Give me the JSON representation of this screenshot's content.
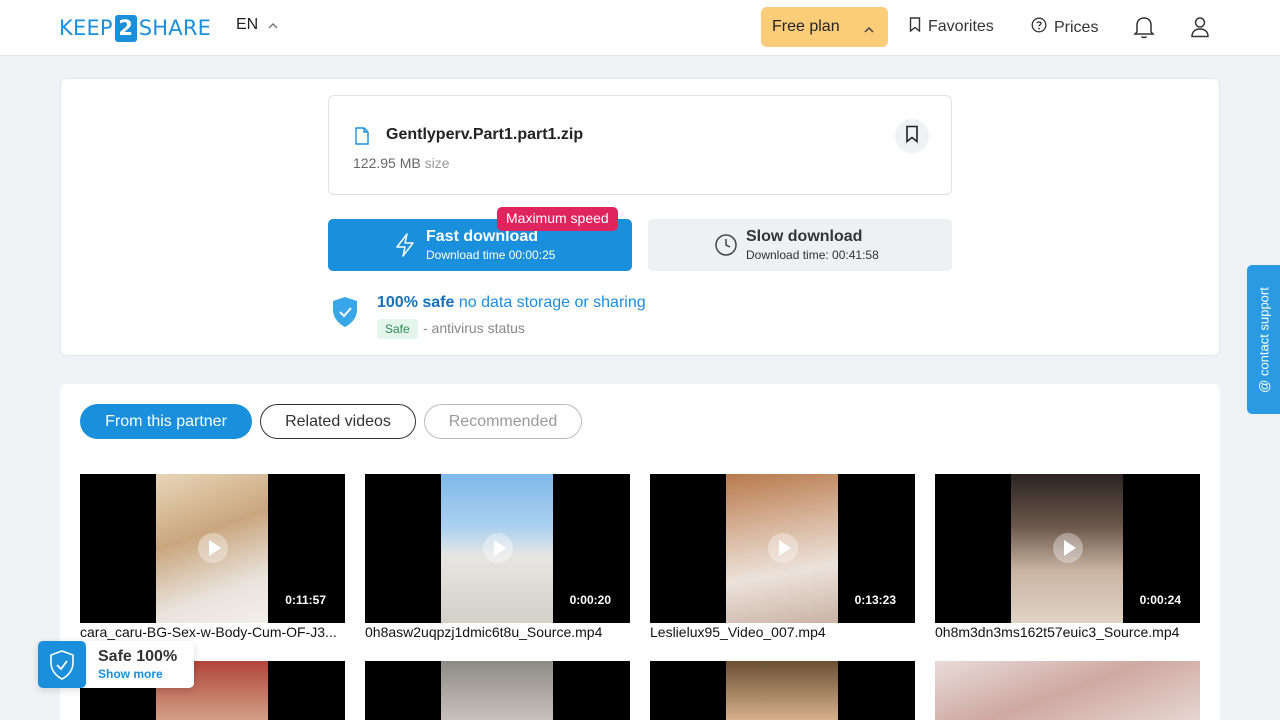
{
  "header": {
    "logo_left": "KEEP",
    "logo_mid": "2",
    "logo_right": "SHARE",
    "language": "EN",
    "free_plan_label": "Free plan",
    "favorites_label": "Favorites",
    "prices_label": "Prices"
  },
  "file": {
    "name": "Gentlyperv.Part1.part1.zip",
    "size_value": "122.95 MB",
    "size_unit": "size"
  },
  "download": {
    "badge": "Maximum speed",
    "fast_title": "Fast download",
    "fast_sub": "Download time 00:00:25",
    "slow_title": "Slow download",
    "slow_sub": "Download time: 00:41:58"
  },
  "safety": {
    "strong": "100% safe",
    "rest": " no data storage or sharing",
    "tag": "Safe",
    "sub": "- antivirus status"
  },
  "tabs": [
    "From this partner",
    "Related videos",
    "Recommended"
  ],
  "videos": [
    {
      "title": "cara_caru-BG-Sex-w-Body-Cum-OF-J3...",
      "duration": "0:11:57"
    },
    {
      "title": "0h8asw2uqpzj1dmic6t8u_Source.mp4",
      "duration": "0:00:20"
    },
    {
      "title": "Leslielux95_Video_007.mp4",
      "duration": "0:13:23"
    },
    {
      "title": "0h8m3dn3ms162t57euic3_Source.mp4",
      "duration": "0:00:24"
    }
  ],
  "support_label": "@ contact support",
  "safe_widget": {
    "title": "Safe 100%",
    "link": "Show more"
  },
  "colors": {
    "accent": "#1a8fdc",
    "plan": "#fbcd78",
    "badge": "#e0245e"
  }
}
